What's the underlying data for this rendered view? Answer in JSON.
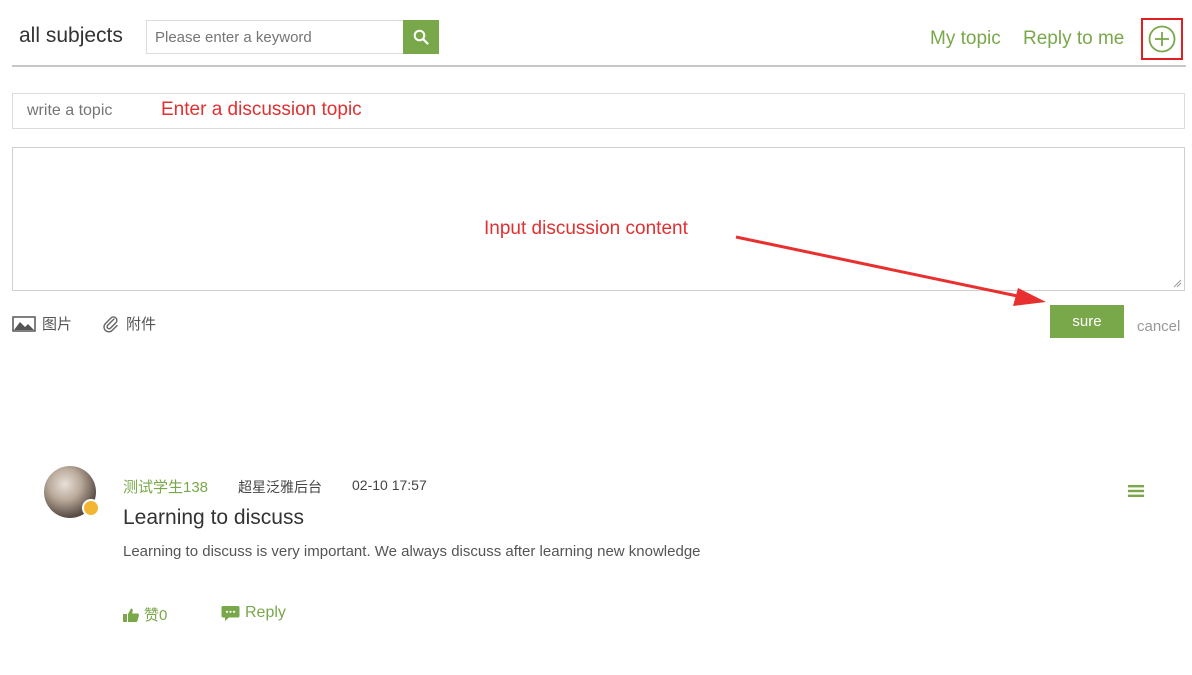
{
  "header": {
    "subjects_label": "all subjects",
    "search_placeholder": "Please enter a keyword",
    "my_topic": "My topic",
    "reply_to_me": "Reply to me",
    "add_icon": "plus-circle-icon"
  },
  "editor": {
    "topic_placeholder": "write a topic",
    "topic_annotation": "Enter a discussion topic",
    "content_annotation": "Input discussion content",
    "image_label": "图片",
    "attach_label": "附件",
    "sure_label": "sure",
    "cancel_label": "cancel"
  },
  "post": {
    "author": "测试学生138",
    "source": "超星泛雅后台",
    "time": "02-10 17:57",
    "title": "Learning to discuss",
    "body": "Learning to discuss is very important. We always discuss after learning new knowledge",
    "like_label": "赞0",
    "reply_label": "Reply"
  },
  "colors": {
    "accent_green": "#79a84a",
    "annotation_red": "#e03030"
  }
}
